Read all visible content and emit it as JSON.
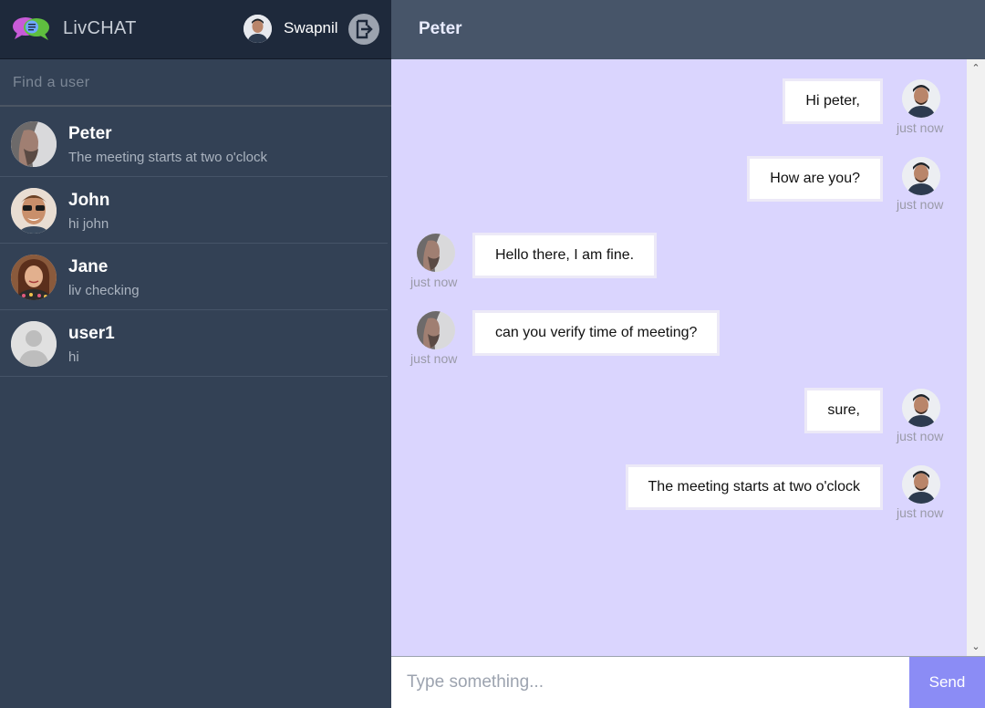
{
  "app": {
    "name": "LivCHAT",
    "logo_icon": "chat-bubbles-logo",
    "accent": "#8b8cf5"
  },
  "current_user": {
    "name": "Swapnil",
    "avatar_icon": "person-avatar",
    "logout_icon": "logout-icon"
  },
  "search": {
    "placeholder": "Find a user"
  },
  "users": [
    {
      "name": "Peter",
      "last_message": "The meeting starts at two o'clock"
    },
    {
      "name": "John",
      "last_message": "hi john"
    },
    {
      "name": "Jane",
      "last_message": "liv checking"
    },
    {
      "name": "user1",
      "last_message": "hi"
    }
  ],
  "chat": {
    "title": "Peter",
    "messages": [
      {
        "text": "Hi peter,",
        "time": "just now",
        "from": "me"
      },
      {
        "text": "How are you?",
        "time": "just now",
        "from": "me"
      },
      {
        "text": "Hello there, I am fine.",
        "time": "just now",
        "from": "Peter"
      },
      {
        "text": "can you verify time of meeting?",
        "time": "just now",
        "from": "Peter"
      },
      {
        "text": "sure,",
        "time": "just now",
        "from": "me"
      },
      {
        "text": "The meeting starts at two o'clock",
        "time": "just now",
        "from": "me"
      }
    ]
  },
  "composer": {
    "placeholder": "Type something...",
    "send_label": "Send"
  },
  "scrollbar": {
    "up_icon": "chevron-up-icon",
    "down_icon": "chevron-down-icon"
  }
}
